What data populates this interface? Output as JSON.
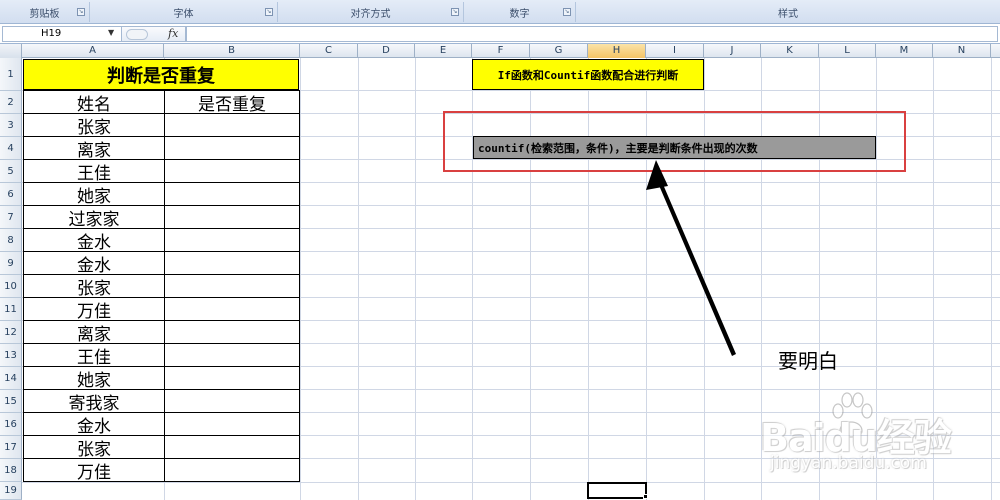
{
  "ribbon": {
    "groups": [
      {
        "label": "剪贴板"
      },
      {
        "label": "字体"
      },
      {
        "label": "对齐方式"
      },
      {
        "label": "数字"
      },
      {
        "label": "样式"
      }
    ]
  },
  "formula_bar": {
    "name_box": "H19",
    "fx_label": "fx",
    "formula": ""
  },
  "columns": [
    "A",
    "B",
    "C",
    "D",
    "E",
    "F",
    "G",
    "H",
    "I",
    "J",
    "K",
    "L",
    "M",
    "N"
  ],
  "active_column": "H",
  "rows": [
    "1",
    "2",
    "3",
    "4",
    "5",
    "6",
    "7",
    "8",
    "9",
    "10",
    "11",
    "12",
    "13",
    "14",
    "15",
    "16",
    "17",
    "18",
    "19"
  ],
  "table": {
    "title": "判断是否重复",
    "header_name": "姓名",
    "header_dup": "是否重复",
    "names": [
      "张家",
      "离家",
      "王佳",
      "她家",
      "过家家",
      "金水",
      "金水",
      "张家",
      "万佳",
      "离家",
      "王佳",
      "她家",
      "寄我家",
      "金水",
      "张家",
      "万佳"
    ]
  },
  "annotations": {
    "yellow_note": "If函数和Countif函数配合进行判断",
    "gray_note": "countif(检索范围，条件)，主要是判断条件出现的次数",
    "callout": "要明白",
    "frame_color": "#d94040",
    "highlight_color": "#ffff00"
  },
  "watermark": {
    "logo": "Baidu经验",
    "url": "jingyan.baidu.com"
  }
}
